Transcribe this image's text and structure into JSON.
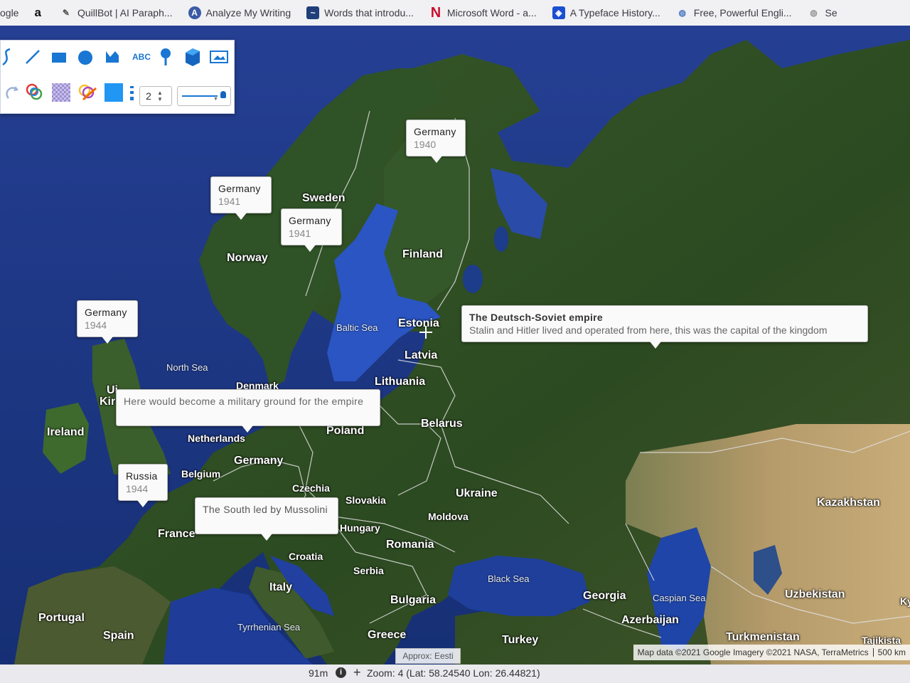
{
  "bookmarks": [
    {
      "label": "ogle",
      "icon": "google-icon"
    },
    {
      "label": "a",
      "icon": "amazon-icon"
    },
    {
      "label": "QuillBot | AI Paraph...",
      "icon": "quillbot-icon"
    },
    {
      "label": "Analyze My Writing",
      "icon": "analyze-icon"
    },
    {
      "label": "Words that introdu...",
      "icon": "words-icon"
    },
    {
      "label": "Microsoft Word - a...",
      "icon": "netflix-icon"
    },
    {
      "label": "A Typeface History...",
      "icon": "typeface-icon"
    },
    {
      "label": "Free, Powerful Engli...",
      "icon": "globe-icon"
    },
    {
      "label": "Se",
      "icon": "globe-icon"
    }
  ],
  "toolbar": {
    "text_tool_label": "ABC",
    "line_width_value": "2",
    "fill_color": "#2196f3"
  },
  "callouts": [
    {
      "title": "Germany",
      "subtitle": "1940"
    },
    {
      "title": "Germany",
      "subtitle": "1941"
    },
    {
      "title": "Germany",
      "subtitle": "1941"
    },
    {
      "title": "Germany",
      "subtitle": "1944"
    },
    {
      "title": "The Deutsch-Soviet empire",
      "subtitle": "Stalin and Hitler lived and operated from here, this was the capital of the kingdom"
    },
    {
      "title": "Here would become a military ground for the empire",
      "subtitle": ""
    },
    {
      "title": "Russia",
      "subtitle": "1944"
    },
    {
      "title": "The South led by Mussolini",
      "subtitle": ""
    }
  ],
  "labels": {
    "sweden": "Sweden",
    "norway": "Norway",
    "finland": "Finland",
    "estonia": "Estonia",
    "latvia": "Latvia",
    "lithuania": "Lithuania",
    "belarus": "Belarus",
    "poland": "Poland",
    "denmark": "Denmark",
    "netherlands": "Netherlands",
    "belgium": "Belgium",
    "germany": "Germany",
    "czechia": "Czechia",
    "slovakia": "Slovakia",
    "ukraine": "Ukraine",
    "moldova": "Moldova",
    "hungary": "Hungary",
    "romania": "Romania",
    "croatia": "Croatia",
    "serbia": "Serbia",
    "bulgaria": "Bulgaria",
    "greece": "Greece",
    "turkey": "Turkey",
    "italy": "Italy",
    "france": "France",
    "spain": "Spain",
    "portugal": "Portugal",
    "ireland": "Ireland",
    "uk": "Ui",
    "uk2": "Kir",
    "georgia": "Georgia",
    "azerbaijan": "Azerbaijan",
    "kazakhstan": "Kazakhstan",
    "uzbekistan": "Uzbekistan",
    "turkmenistan": "Turkmenistan",
    "tajikistan": "Tajikista",
    "ky": "Ky"
  },
  "seas": {
    "baltic": "Baltic Sea",
    "north": "North Sea",
    "black": "Black Sea",
    "caspian": "Caspian Sea",
    "tyrrhenian": "Tyrrhenian Sea"
  },
  "map_footer": {
    "approx": "Approx: Eesti",
    "attribution": "Map data ©2021 Google Imagery ©2021 NASA, TerraMetrics",
    "scale": "500 km"
  },
  "status": {
    "elevation": "91m",
    "zoom_text": "Zoom: 4 (Lat: 58.24540 Lon: 26.44821)"
  },
  "colors": {
    "water": "#1b3d8f",
    "land": "#2f4d22",
    "arid": "#b59a6a",
    "border": "#e8e8e8"
  }
}
